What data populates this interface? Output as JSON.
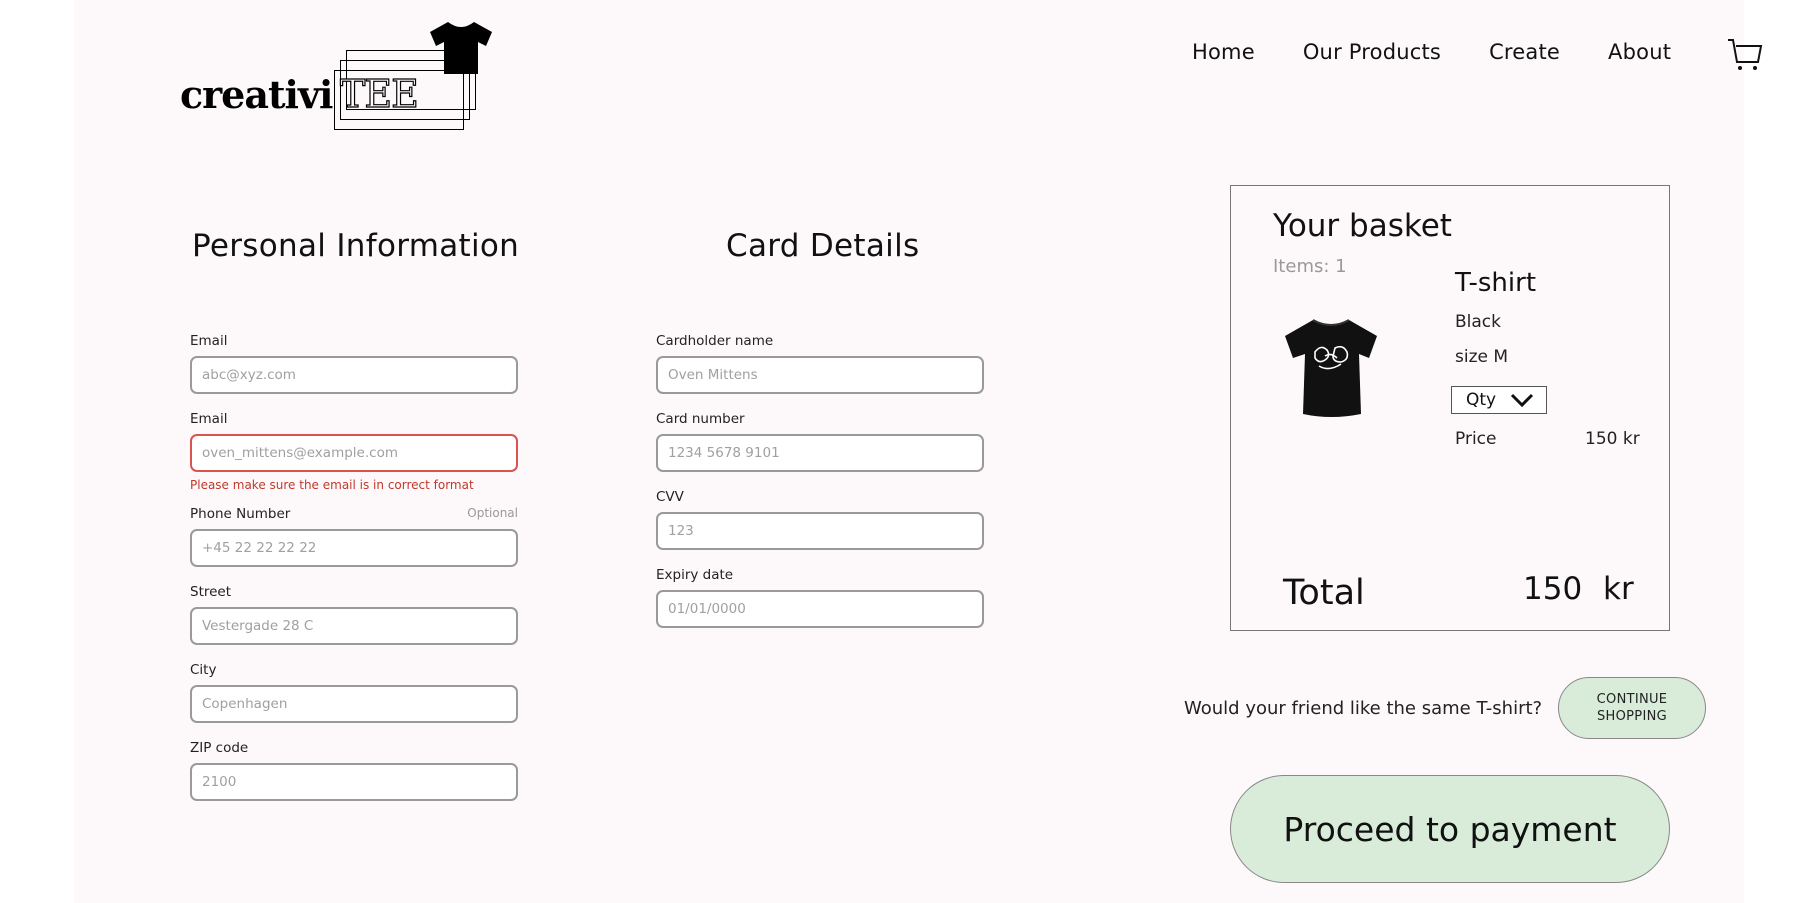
{
  "logo": {
    "word": "creativi",
    "tee": "TEE",
    "shirt_icon": "tshirt-icon"
  },
  "nav": {
    "items": [
      "Home",
      "Our Products",
      "Create",
      "About"
    ],
    "cart_icon": "shopping-cart-icon"
  },
  "personal": {
    "title": "Personal Information",
    "email1": {
      "label": "Email",
      "placeholder": "abc@xyz.com"
    },
    "email2": {
      "label": "Email",
      "placeholder": "oven_mittens@example.com",
      "error": "Please make sure the email is in correct format"
    },
    "phone": {
      "label": "Phone Number",
      "optional": "Optional",
      "placeholder": "+45 22 22 22 22"
    },
    "street": {
      "label": "Street",
      "placeholder": "Vestergade 28 C"
    },
    "city": {
      "label": "City",
      "placeholder": "Copenhagen"
    },
    "zip": {
      "label": "ZIP code",
      "placeholder": "2100"
    }
  },
  "card": {
    "title": "Card Details",
    "holder": {
      "label": "Cardholder name",
      "placeholder": "Oven Mittens"
    },
    "number": {
      "label": "Card number",
      "placeholder": "1234 5678 9101"
    },
    "cvv": {
      "label": "CVV",
      "placeholder": "123"
    },
    "expiry": {
      "label": "Expiry date",
      "placeholder": "01/01/0000"
    }
  },
  "basket": {
    "title": "Your basket",
    "items": "Items: 1",
    "product": {
      "name": "T-shirt",
      "color": "Black",
      "size": "size M",
      "qty_label": "Qty",
      "price_label": "Price",
      "price_value": "150 kr"
    },
    "total_label": "Total",
    "total_value": "150",
    "total_currency": "kr"
  },
  "friend": {
    "question": "Would your friend like the same T-shirt?",
    "continue_label": "CONTINUE\nSHOPPING"
  },
  "proceed_label": "Proceed to payment",
  "colors": {
    "button_green": "#d9ecd9",
    "error_red": "#d9534f",
    "page_bg": "#fdf9fb"
  }
}
